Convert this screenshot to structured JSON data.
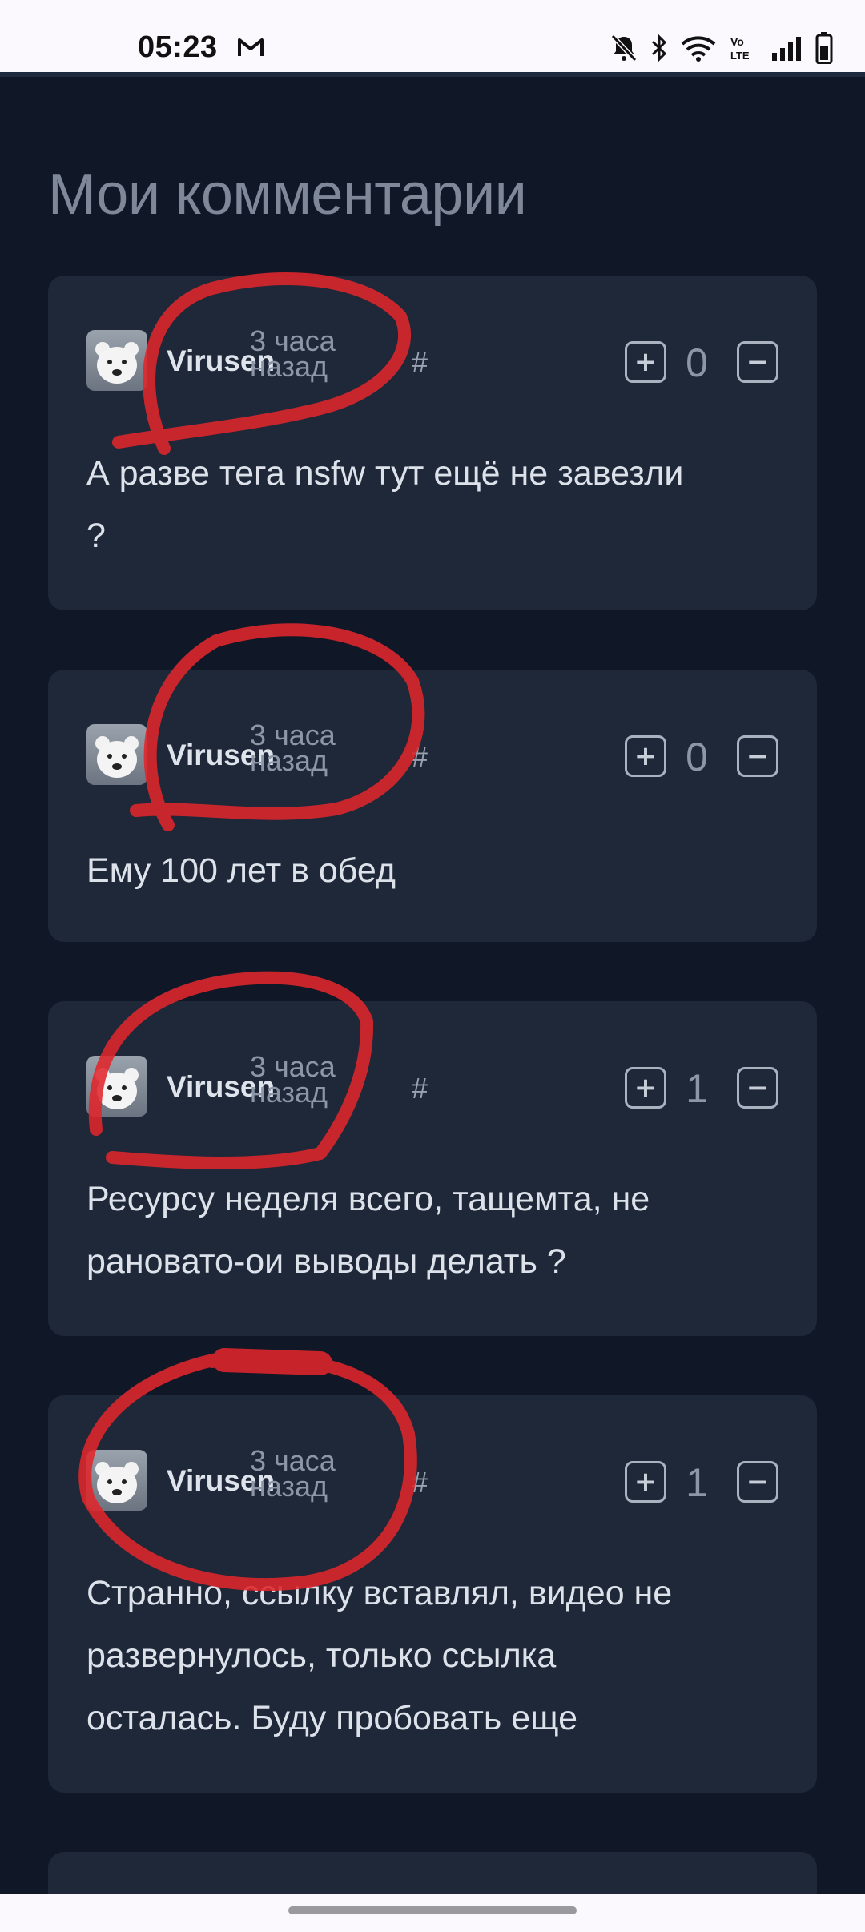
{
  "status_bar": {
    "time": "05:23",
    "icons": [
      "gmail-icon",
      "bell-off-icon",
      "bluetooth-icon",
      "wifi-icon",
      "volte-icon",
      "signal-icon",
      "battery-icon"
    ]
  },
  "page_title": "Мои комментарии",
  "colors": {
    "background": "#101828",
    "card": "#1e2839",
    "scribble": "#e0252b"
  },
  "comments": [
    {
      "author": "Virusen",
      "time_line1": "3 часа",
      "time_line2": "назад",
      "anchor": "#",
      "score": "0",
      "plus": "+",
      "minus": "−",
      "text_lines": [
        "А разве тега nsfw тут ещё не завезли",
        "?"
      ]
    },
    {
      "author": "Virusen",
      "time_line1": "3 часа",
      "time_line2": "назад",
      "anchor": "#",
      "score": "0",
      "plus": "+",
      "minus": "−",
      "text_lines": [
        "Ему 100 лет в обед"
      ]
    },
    {
      "author": "Virusen",
      "time_line1": "3 часа",
      "time_line2": "назад",
      "anchor": "#",
      "score": "1",
      "plus": "+",
      "minus": "−",
      "text_lines": [
        "Ресурсу неделя всего, тащемта, не",
        "рановато-ои выводы делать ?"
      ]
    },
    {
      "author": "Virusen",
      "time_line1": "3 часа",
      "time_line2": "назад",
      "anchor": "#",
      "score": "1",
      "plus": "+",
      "minus": "−",
      "text_lines": [
        "Странно, ссылку вставлял, видео не",
        "развернулось, только ссылка",
        "осталась. Буду пробовать еще"
      ]
    }
  ]
}
